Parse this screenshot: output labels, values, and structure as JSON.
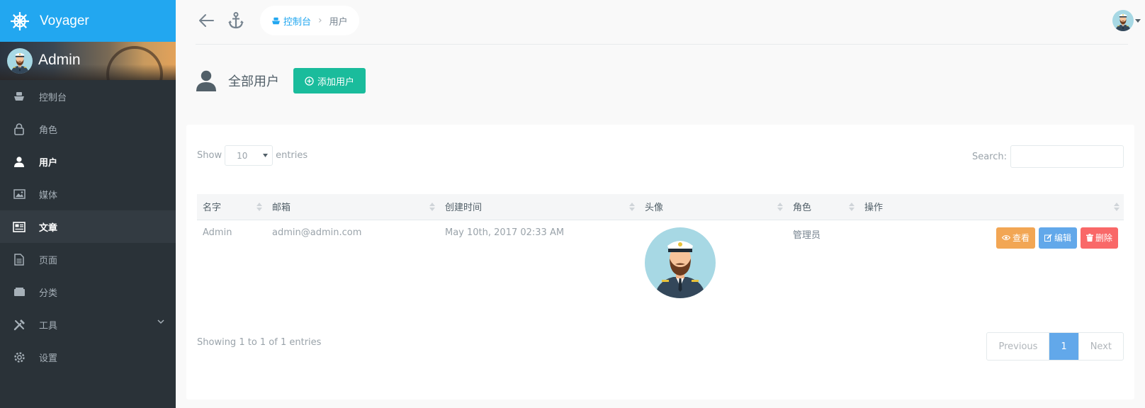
{
  "brand": {
    "name": "Voyager"
  },
  "profile": {
    "name": "Admin"
  },
  "sidebar": {
    "items": [
      {
        "label": "控制台",
        "icon": "boat-icon"
      },
      {
        "label": "角色",
        "icon": "lock-icon"
      },
      {
        "label": "用户",
        "icon": "person-icon"
      },
      {
        "label": "媒体",
        "icon": "image-icon"
      },
      {
        "label": "文章",
        "icon": "news-icon"
      },
      {
        "label": "页面",
        "icon": "file-text-icon"
      },
      {
        "label": "分类",
        "icon": "categories-icon"
      },
      {
        "label": "工具",
        "icon": "tools-icon"
      },
      {
        "label": "设置",
        "icon": "gear-icon"
      }
    ]
  },
  "breadcrumb": {
    "home": "控制台",
    "current": "用户"
  },
  "page": {
    "title": "全部用户",
    "add_button": "添加用户"
  },
  "table": {
    "length_label_before": "Show",
    "length_value": "10",
    "length_label_after": "entries",
    "search_label": "Search:",
    "columns": [
      "名字",
      "邮箱",
      "创建时间",
      "头像",
      "角色",
      "操作"
    ],
    "rows": [
      {
        "name": "Admin",
        "email": "admin@admin.com",
        "created": "May 10th, 2017 02:33 AM",
        "role": "管理员"
      }
    ],
    "actions": {
      "view": "查看",
      "edit": "编辑",
      "delete": "删除"
    },
    "info": "Showing 1 to 1 of 1 entries"
  },
  "pagination": {
    "previous": "Previous",
    "current": "1",
    "next": "Next"
  },
  "colors": {
    "brand": "#22a7f0",
    "sidebar": "#2a3238",
    "add": "#1abc9c",
    "view": "#f2a654",
    "edit": "#62a8ea",
    "delete": "#f96868"
  }
}
